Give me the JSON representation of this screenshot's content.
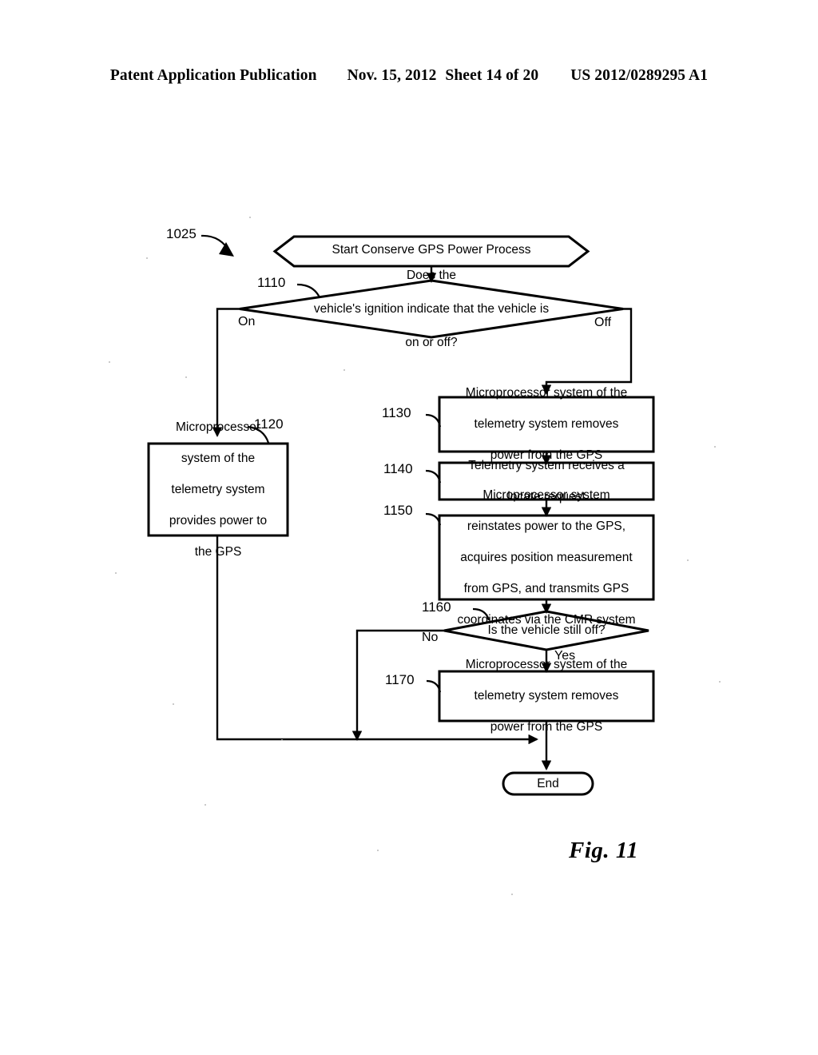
{
  "header": {
    "publication": "Patent Application Publication",
    "date": "Nov. 15, 2012",
    "sheet": "Sheet 14 of 20",
    "number": "US 2012/0289295 A1"
  },
  "figure": {
    "caption": "Fig. 11",
    "process_ref": "1025"
  },
  "flowchart": {
    "start": {
      "ref": "1025",
      "label": "Start Conserve GPS Power Process"
    },
    "nodes": [
      {
        "ref": "1110",
        "type": "decision",
        "label": "Does the vehicle's ignition indicate that the vehicle is on or off?",
        "lines": [
          "Does the",
          "vehicle's ignition indicate that the vehicle is",
          "on or off?"
        ],
        "branches": [
          "On",
          "Off"
        ]
      },
      {
        "ref": "1120",
        "type": "process",
        "label": "Microprocessor system of the telemetry system provides power to the GPS",
        "lines": [
          "Microprocessor",
          "system of the",
          "telemetry system",
          "provides power to",
          "the GPS"
        ]
      },
      {
        "ref": "1130",
        "type": "process",
        "label": "Microprocessor system of the telemetry system removes power from the GPS",
        "lines": [
          "Microprocessor system of the",
          "telemetry system removes",
          "power from the GPS"
        ]
      },
      {
        "ref": "1140",
        "type": "process",
        "label": "Telemetry system receives a locate request",
        "lines": [
          "Telemetry system receives a",
          "locate request"
        ]
      },
      {
        "ref": "1150",
        "type": "process",
        "label": "Microprocessor system reinstates power to the GPS, acquires position measurement from GPS, and transmits GPS coordinates via the CMR system",
        "lines": [
          "Microprocessor system",
          "reinstates power to the GPS,",
          "acquires position measurement",
          "from GPS, and transmits GPS",
          "coordinates via the CMR system"
        ]
      },
      {
        "ref": "1160",
        "type": "decision",
        "label": "Is the vehicle still off?",
        "lines": [
          "Is the vehicle still off?"
        ],
        "branches": [
          "No",
          "Yes"
        ]
      },
      {
        "ref": "1170",
        "type": "process",
        "label": "Microprocessor system of the telemetry system removes power from the GPS",
        "lines": [
          "Microprocessor system of the",
          "telemetry system removes",
          "power from the GPS"
        ]
      }
    ],
    "end": {
      "label": "End"
    },
    "edge_labels": {
      "on": "On",
      "off": "Off",
      "no": "No",
      "yes": "Yes"
    }
  },
  "colors": {
    "ink": "#000000",
    "page": "#ffffff"
  }
}
